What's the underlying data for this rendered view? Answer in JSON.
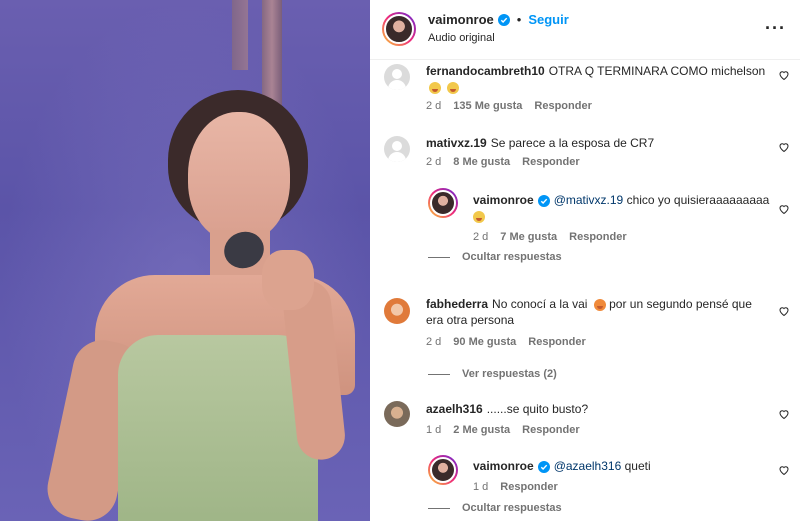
{
  "header": {
    "username": "vaimonroe",
    "separator": "•",
    "follow_label": "Seguir",
    "audio_label": "Audio original",
    "more_label": "···"
  },
  "colors": {
    "accent": "#0095f6",
    "verified": "#0095f6",
    "muted": "#737373",
    "mention": "#00376b"
  },
  "comments": [
    {
      "username": "fernandocambreth10",
      "text": "OTRA Q TERMINARA COMO michelson",
      "time": "2 d",
      "likes": "135 Me gusta",
      "reply": "Responder",
      "emojis": [
        "sad-face-emoji",
        "sad-face-emoji"
      ]
    },
    {
      "username": "mativxz.19",
      "text": "Se parece a la esposa de CR7",
      "time": "2 d",
      "likes": "8 Me gusta",
      "reply": "Responder"
    },
    {
      "username": "vaimonroe",
      "mention": "@mativxz.19",
      "text": "chico yo quisieraaaaaaaaa",
      "time": "2 d",
      "likes": "7 Me gusta",
      "reply": "Responder",
      "emojis": [
        "sad-face-emoji"
      ]
    },
    {
      "username": "fabhederra",
      "text_line1": "No conocí a la vai",
      "text_line1b": "por un segundo pensé que",
      "text_line2": "era otra persona",
      "time": "2 d",
      "likes": "90 Me gusta",
      "reply": "Responder",
      "emojis": [
        "shocked-face-emoji"
      ]
    },
    {
      "username": "azaelh316",
      "text": "......se quito busto?",
      "time": "1 d",
      "likes": "2 Me gusta",
      "reply": "Responder"
    },
    {
      "username": "vaimonroe",
      "mention": "@azaelh316",
      "text": "queti",
      "time": "1 d",
      "reply": "Responder"
    }
  ],
  "links": {
    "hide_replies_1": "Ocultar respuestas",
    "view_replies": "Ver respuestas (2)",
    "hide_replies_2": "Ocultar respuestas"
  }
}
